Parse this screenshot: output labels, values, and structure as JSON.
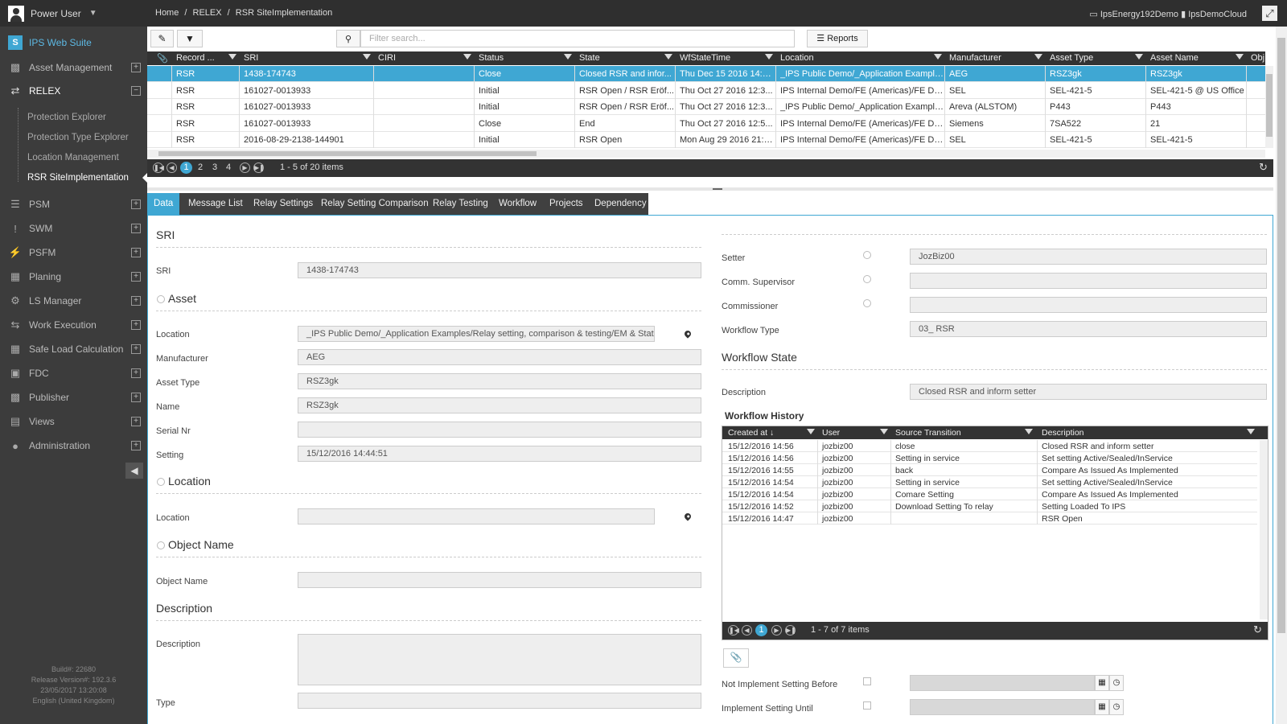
{
  "user": {
    "name": "Power User"
  },
  "app": {
    "title": "IPS Web Suite"
  },
  "sidebar": {
    "items": [
      {
        "label": "Asset Management",
        "icon": "folder-open-icon",
        "toggle": "+"
      },
      {
        "label": "RELEX",
        "icon": "shuffle-icon",
        "toggle": "−"
      },
      {
        "label": "PSM",
        "icon": "database-icon",
        "toggle": "+"
      },
      {
        "label": "SWM",
        "icon": "exclamation-icon",
        "toggle": "+"
      },
      {
        "label": "PSFM",
        "icon": "bolt-icon",
        "toggle": "+"
      },
      {
        "label": "Planing",
        "icon": "calendar-icon",
        "toggle": "+"
      },
      {
        "label": "LS Manager",
        "icon": "cogs-icon",
        "toggle": "+"
      },
      {
        "label": "Work Execution",
        "icon": "exchange-icon",
        "toggle": "+"
      },
      {
        "label": "Safe Load Calculation",
        "icon": "table-icon",
        "toggle": "+"
      },
      {
        "label": "FDC",
        "icon": "image-icon",
        "toggle": "+"
      },
      {
        "label": "Publisher",
        "icon": "bar-chart-icon",
        "toggle": "+"
      },
      {
        "label": "Views",
        "icon": "inbox-icon",
        "toggle": "+"
      },
      {
        "label": "Administration",
        "icon": "user-icon",
        "toggle": "+"
      }
    ],
    "relex_sub": [
      "Protection Explorer",
      "Protection Type Explorer",
      "Location Management",
      "RSR SiteImplementation"
    ],
    "build": [
      "Build#: 22680",
      "Release Version#: 192.3.6",
      "23/05/2017 13:20:08",
      "English (United Kingdom)"
    ]
  },
  "breadcrumb": [
    "Home",
    "/",
    "RELEX",
    "/",
    "RSR SiteImplementation"
  ],
  "topbar_right": {
    "server": "IpsEnergy192Demo",
    "cloud": "IpsDemoCloud"
  },
  "toolbar": {
    "search_placeholder": "Filter search...",
    "reports_label": "Reports"
  },
  "grid": {
    "columns": [
      "Record ...",
      "SRI",
      "CIRI",
      "Status",
      "State",
      "WfStateTime",
      "Location",
      "Manufacturer",
      "Asset Type",
      "Asset Name",
      "Obj"
    ],
    "rows": [
      [
        "RSR",
        "1438-174743",
        "",
        "Close",
        "Closed RSR and infor...",
        "Thu Dec 15 2016 14:5...",
        "_IPS Public Demo/_Application Example...",
        "AEG",
        "RSZ3gk",
        "RSZ3gk"
      ],
      [
        "RSR",
        "161027-0013933",
        "",
        "Initial",
        "RSR Open / RSR Eröf...",
        "Thu Oct 27 2016 12:3...",
        "IPS Internal Demo/FE (Americas)/FE De...",
        "SEL",
        "SEL-421-5",
        "SEL-421-5 @ US Office"
      ],
      [
        "RSR",
        "161027-0013933",
        "",
        "Initial",
        "RSR Open / RSR Eröf...",
        "Thu Oct 27 2016 12:3...",
        "_IPS Public Demo/_Application Example...",
        "Areva (ALSTOM)",
        "P443",
        "P443"
      ],
      [
        "RSR",
        "161027-0013933",
        "",
        "Close",
        "End",
        "Thu Oct 27 2016 12:5...",
        "IPS Internal Demo/FE (Americas)/FE De...",
        "Siemens",
        "7SA522",
        "21"
      ],
      [
        "RSR",
        "2016-08-29-2138-144901",
        "",
        "Initial",
        "RSR Open",
        "Mon Aug 29 2016 21:4...",
        "IPS Internal Demo/FE (Americas)/FE De...",
        "SEL",
        "SEL-421-5",
        "SEL-421-5"
      ]
    ],
    "pages": [
      "1",
      "2",
      "3",
      "4"
    ],
    "current_page": "1",
    "pager_info": "1 - 5 of 20 items"
  },
  "tabs": [
    "Data",
    "Message List",
    "Relay Settings",
    "Relay Setting Comparison",
    "Relay Testing",
    "Workflow",
    "Projects",
    "Dependency"
  ],
  "form_left": {
    "sri_section": "SRI",
    "sri_label": "SRI",
    "sri_value": "1438-174743",
    "asset_section": "Asset",
    "location_label": "Location",
    "location_value": "_IPS Public Demo/_Application Examples/Relay setting, comparison & testing/EM & Static/AE",
    "manufacturer_label": "Manufacturer",
    "manufacturer_value": "AEG",
    "asset_type_label": "Asset Type",
    "asset_type_value": "RSZ3gk",
    "name_label": "Name",
    "name_value": "RSZ3gk",
    "serial_label": "Serial Nr",
    "serial_value": "",
    "setting_label": "Setting",
    "setting_value": "15/12/2016 14:44:51",
    "location_section": "Location",
    "location2_label": "Location",
    "location2_value": "",
    "object_section": "Object Name",
    "object_label": "Object Name",
    "object_value": "",
    "description_section": "Description",
    "description_label": "Description",
    "type_label": "Type"
  },
  "form_right": {
    "setter_label": "Setter",
    "setter_value": "JozBiz00",
    "comm_label": "Comm. Supervisor",
    "comm_value": "",
    "commissioner_label": "Commissioner",
    "commissioner_value": "",
    "workflow_type_label": "Workflow Type",
    "workflow_type_value": "03_ RSR",
    "workflow_state_section": "Workflow State",
    "description_label": "Description",
    "description_value": "Closed RSR and inform setter",
    "history_section": "Workflow History",
    "not_implement_label": "Not Implement Setting Before",
    "implement_until_label": "Implement Setting Until"
  },
  "history": {
    "columns": [
      "Created at ↓",
      "User",
      "Source Transition",
      "Description"
    ],
    "rows": [
      [
        "15/12/2016 14:56",
        "jozbiz00",
        "close",
        "Closed RSR and inform setter"
      ],
      [
        "15/12/2016 14:56",
        "jozbiz00",
        "Setting in service",
        "Set setting Active/Sealed/InService"
      ],
      [
        "15/12/2016 14:55",
        "jozbiz00",
        "back",
        "Compare As Issued As Implemented"
      ],
      [
        "15/12/2016 14:54",
        "jozbiz00",
        "Setting in service",
        "Set setting Active/Sealed/InService"
      ],
      [
        "15/12/2016 14:54",
        "jozbiz00",
        "Comare Setting",
        "Compare As Issued As Implemented"
      ],
      [
        "15/12/2016 14:52",
        "jozbiz00",
        "Download Setting To relay",
        "Setting Loaded To IPS"
      ],
      [
        "15/12/2016 14:47",
        "jozbiz00",
        "",
        "RSR Open"
      ]
    ],
    "current_page": "1",
    "pager_info": "1 - 7 of 7 items"
  },
  "colors": {
    "accent": "#3fa7d3",
    "sidebar": "#3c3c3c",
    "topbar": "#2f2f2f"
  }
}
